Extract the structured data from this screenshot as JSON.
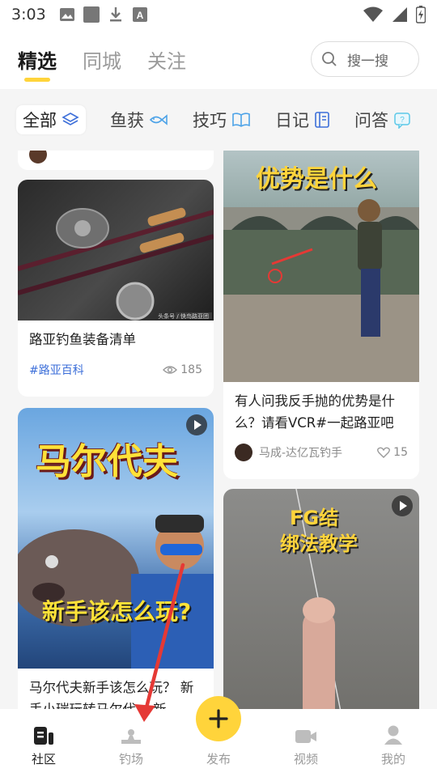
{
  "status_bar": {
    "time": "3:03"
  },
  "top_tabs": [
    {
      "label": "精选",
      "active": true
    },
    {
      "label": "同城",
      "active": false
    },
    {
      "label": "关注",
      "active": false
    }
  ],
  "search": {
    "placeholder": "搜一搜"
  },
  "categories": [
    {
      "label": "全部",
      "icon": "layers-icon",
      "active": true
    },
    {
      "label": "鱼获",
      "icon": "fish-icon",
      "active": false
    },
    {
      "label": "技巧",
      "icon": "book-open-icon",
      "active": false
    },
    {
      "label": "日记",
      "icon": "notebook-icon",
      "active": false
    },
    {
      "label": "问答",
      "icon": "chat-question-icon",
      "active": false
    }
  ],
  "feed": {
    "card_gear": {
      "title": "路亚钓鱼装备清单",
      "tag": "#路亚百科",
      "views": "185",
      "image_watermark": "头条号 / 快鸟路亚团"
    },
    "card_backhand": {
      "image_text": "优势是什么",
      "title": "有人问我反手抛的优势是什么？请看VCR#一起路亚吧 ...",
      "author": "马成-达亿瓦钓手",
      "likes": "15"
    },
    "card_maldives": {
      "image_title": "马尔代夫",
      "image_subtitle": "新手该怎么玩?",
      "title": "马尔代夫新手该怎么玩？ 新手小瑞玩转马尔代... 新"
    },
    "card_fg": {
      "image_title_1": "FG结",
      "image_title_2": "绑法教学"
    }
  },
  "bottom_nav": [
    {
      "label": "社区",
      "icon": "community-icon",
      "active": true
    },
    {
      "label": "钓场",
      "icon": "fishing-spot-icon",
      "active": false
    },
    {
      "label": "发布",
      "icon": "plus-icon",
      "active": false
    },
    {
      "label": "视频",
      "icon": "video-icon",
      "active": false
    },
    {
      "label": "我的",
      "icon": "profile-icon",
      "active": false
    }
  ],
  "colors": {
    "accent_yellow": "#ffd43b",
    "tag_blue": "#3d6fd9",
    "annotation_red": "#e53935"
  }
}
